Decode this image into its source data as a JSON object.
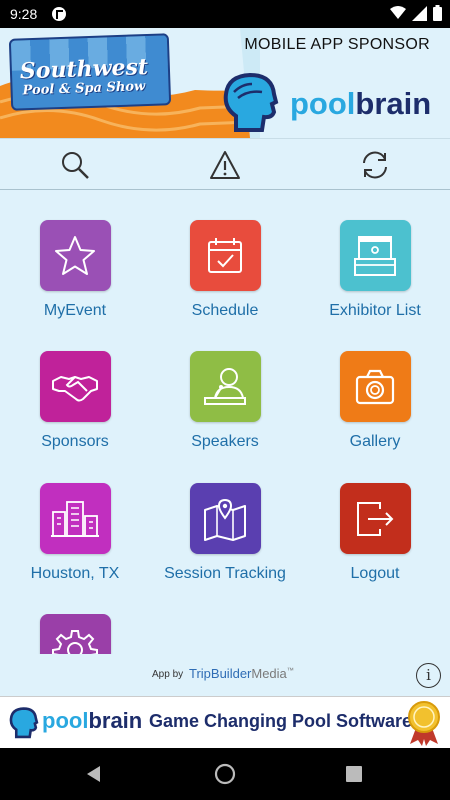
{
  "status": {
    "time": "9:28"
  },
  "banner": {
    "show_title_line1": "Southwest",
    "show_title_line2": "Pool & Spa Show",
    "sponsor_label": "MOBILE APP SPONSOR",
    "brand_pool": "pool",
    "brand_brain": "brain"
  },
  "toolbar": {
    "search_icon": "search-icon",
    "alert_icon": "alert-icon",
    "sync_icon": "sync-icon"
  },
  "grid": {
    "items": [
      {
        "label": "MyEvent",
        "icon": "star-icon",
        "color": "#9a50b5"
      },
      {
        "label": "Schedule",
        "icon": "calendar-icon",
        "color": "#e84c3d"
      },
      {
        "label": "Exhibitor List",
        "icon": "booth-icon",
        "color": "#4cc1cf"
      },
      {
        "label": "Sponsors",
        "icon": "handshake-icon",
        "color": "#c0229a"
      },
      {
        "label": "Speakers",
        "icon": "speaker-icon",
        "color": "#8fbd45"
      },
      {
        "label": "Gallery",
        "icon": "camera-icon",
        "color": "#ef7b17"
      },
      {
        "label": "Houston, TX",
        "icon": "city-icon",
        "color": "#c12fbf"
      },
      {
        "label": "Session Tracking",
        "icon": "map-icon",
        "color": "#5a3fb0"
      },
      {
        "label": "Logout",
        "icon": "logout-icon",
        "color": "#c22e1c"
      },
      {
        "label": "",
        "icon": "gear-icon",
        "color": "#9a3fa8"
      }
    ]
  },
  "footer": {
    "app_by": "App by",
    "trip": "TripBuilder",
    "media": "Media",
    "tm": "™",
    "info": "i"
  },
  "ad": {
    "brand_pool": "pool",
    "brand_brain": "brain",
    "tagline": "Game Changing Pool Software"
  }
}
